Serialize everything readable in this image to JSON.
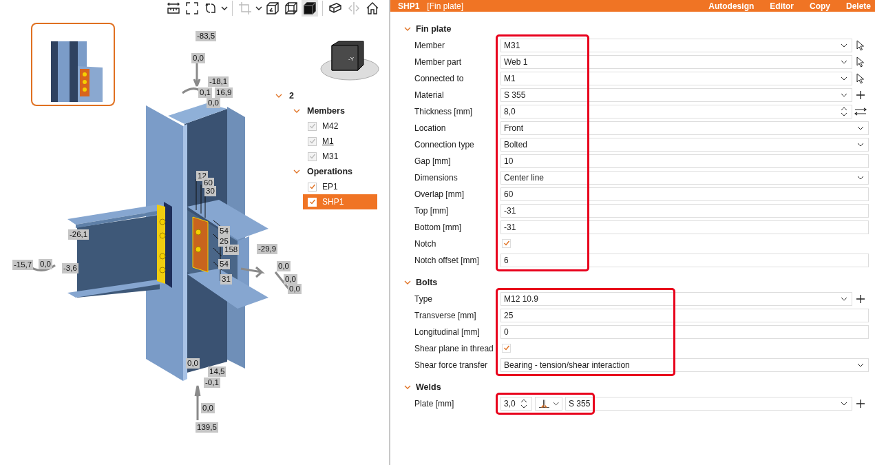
{
  "viewport": {
    "cube_label": "-Y",
    "labels": [
      "-83,5",
      "0,0",
      "-18,1",
      "0,1",
      "16,9",
      "0,0",
      "12",
      "60",
      "30",
      "54",
      "25",
      "158",
      "54",
      "31",
      "-26,1",
      "-15,7",
      "0,0",
      "-3,6",
      "-29,9",
      "0,0",
      "0,0",
      "0,0",
      "0,0",
      "14,5",
      "-0,1",
      "0,0",
      "139,5"
    ],
    "toolbar": [
      {
        "kind": "measure",
        "disabled": false,
        "selected": false
      },
      {
        "kind": "fit",
        "disabled": false,
        "selected": false
      },
      {
        "kind": "rotate",
        "disabled": false,
        "selected": false
      },
      {
        "kind": "caret",
        "disabled": false,
        "selected": false
      },
      {
        "kind": "crop",
        "disabled": true,
        "selected": false
      },
      {
        "kind": "caret",
        "disabled": false,
        "selected": false
      },
      {
        "kind": "wire",
        "disabled": false,
        "selected": false
      },
      {
        "kind": "hidden",
        "disabled": false,
        "selected": false
      },
      {
        "kind": "solid",
        "disabled": false,
        "selected": true
      },
      {
        "kind": "beam",
        "disabled": false,
        "selected": false
      },
      {
        "kind": "mirror",
        "disabled": true,
        "selected": false
      },
      {
        "kind": "home",
        "disabled": false,
        "selected": false
      }
    ]
  },
  "tree": {
    "label": "2",
    "expanded": true,
    "children": [
      {
        "label": "Members",
        "expanded": true,
        "children": [
          {
            "label": "M42",
            "checked": true,
            "disabled": true,
            "underlined": false,
            "selected": false
          },
          {
            "label": "M1",
            "checked": true,
            "disabled": true,
            "underlined": true,
            "selected": false
          },
          {
            "label": "M31",
            "checked": true,
            "disabled": true,
            "underlined": false,
            "selected": false
          }
        ]
      },
      {
        "label": "Operations",
        "expanded": true,
        "children": [
          {
            "label": "EP1",
            "checked": true,
            "disabled": false,
            "underlined": false,
            "selected": false
          },
          {
            "label": "SHP1",
            "checked": true,
            "disabled": false,
            "underlined": false,
            "selected": true
          }
        ]
      }
    ]
  },
  "header": {
    "title": "SHP1",
    "subtitle": "[Fin plate]",
    "actions": [
      "Autodesign",
      "Editor",
      "Copy",
      "Delete"
    ]
  },
  "sections": [
    {
      "title": "Fin plate",
      "expanded": true,
      "highlighted": true,
      "rows": [
        {
          "label": "Member",
          "kind": "select",
          "value": "M31",
          "button": {
            "kind": "pick"
          }
        },
        {
          "label": "Member part",
          "kind": "select",
          "value": "Web 1",
          "button": {
            "kind": "pick"
          }
        },
        {
          "label": "Connected to",
          "kind": "select",
          "value": "M1",
          "button": {
            "kind": "pick"
          }
        },
        {
          "label": "Material",
          "kind": "select",
          "value": "S 355",
          "button": {
            "kind": "plus"
          }
        },
        {
          "label": "Thickness [mm]",
          "kind": "spin",
          "value": "8,0",
          "button": {
            "kind": "swap"
          }
        },
        {
          "label": "Location",
          "kind": "select",
          "value": "Front"
        },
        {
          "label": "Connection type",
          "kind": "select",
          "value": "Bolted"
        },
        {
          "label": "Gap [mm]",
          "kind": "input",
          "value": "10"
        },
        {
          "label": "Dimensions",
          "kind": "select",
          "value": "Center line"
        },
        {
          "label": "Overlap [mm]",
          "kind": "input",
          "value": "60"
        },
        {
          "label": "Top [mm]",
          "kind": "input",
          "value": "-31"
        },
        {
          "label": "Bottom [mm]",
          "kind": "input",
          "value": "-31"
        },
        {
          "label": "Notch",
          "kind": "checkbox",
          "checked": true
        },
        {
          "label": "Notch offset [mm]",
          "kind": "input",
          "value": "6"
        }
      ]
    },
    {
      "title": "Bolts",
      "expanded": true,
      "highlighted": true,
      "rows": [
        {
          "label": "Type",
          "kind": "select",
          "value": "M12 10.9",
          "button": {
            "kind": "plus"
          }
        },
        {
          "label": "Transverse [mm]",
          "kind": "input",
          "value": "25"
        },
        {
          "label": "Longitudinal [mm]",
          "kind": "input",
          "value": "0"
        },
        {
          "label": "Shear plane in thread",
          "kind": "checkbox",
          "checked": true
        },
        {
          "label": "Shear force transfer",
          "kind": "select",
          "value": "Bearing - tension/shear interaction"
        }
      ]
    },
    {
      "title": "Welds",
      "expanded": true,
      "highlighted": true,
      "rows": [
        {
          "label": "Plate [mm]",
          "kind": "weld",
          "size": "3,0",
          "material": "S 355",
          "button": {
            "kind": "plus"
          }
        }
      ]
    }
  ]
}
